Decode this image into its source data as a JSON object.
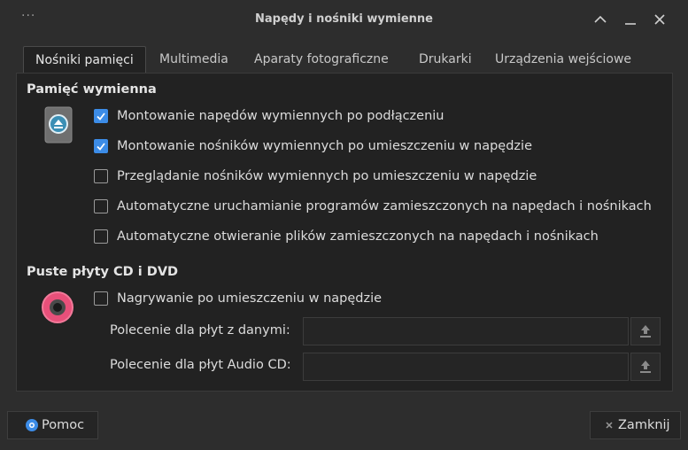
{
  "window": {
    "title": "Napędy i nośniki wymienne"
  },
  "tabs": [
    {
      "label": "Nośniki pamięci",
      "active": true
    },
    {
      "label": "Multimedia"
    },
    {
      "label": "Aparaty fotograficzne"
    },
    {
      "label": "Drukarki"
    },
    {
      "label": "Urządzenia wejściowe"
    }
  ],
  "removable": {
    "heading": "Pamięć wymienna",
    "options": [
      {
        "label": "Montowanie napędów wymiennych po podłączeniu",
        "checked": true
      },
      {
        "label": "Montowanie nośników wymiennych po umieszczeniu w napędzie",
        "checked": true
      },
      {
        "label": "Przeglądanie nośników wymiennych po umieszczeniu w napędzie",
        "checked": false
      },
      {
        "label": "Automatyczne uruchamianie programów zamieszczonych na napędach i nośnikach",
        "checked": false
      },
      {
        "label": "Automatyczne otwieranie plików zamieszczonych na napędach i nośnikach",
        "checked": false
      }
    ]
  },
  "blank_cd": {
    "heading": "Puste płyty CD i DVD",
    "burn_option": {
      "label": "Nagrywanie po umieszczeniu w napędzie",
      "checked": false
    },
    "data_cd_label": "Polecenie dla płyt z danymi:",
    "audio_cd_label": "Polecenie dla płyt Audio CD:",
    "data_cd_value": "",
    "audio_cd_value": ""
  },
  "footer": {
    "help_label": "Pomoc",
    "close_label": "Zamknij"
  },
  "colors": {
    "accent": "#3c8ce7",
    "disc": "#e8507a"
  },
  "icons": {
    "drive": "eject-drive-icon",
    "disc": "cd-disc-icon"
  }
}
